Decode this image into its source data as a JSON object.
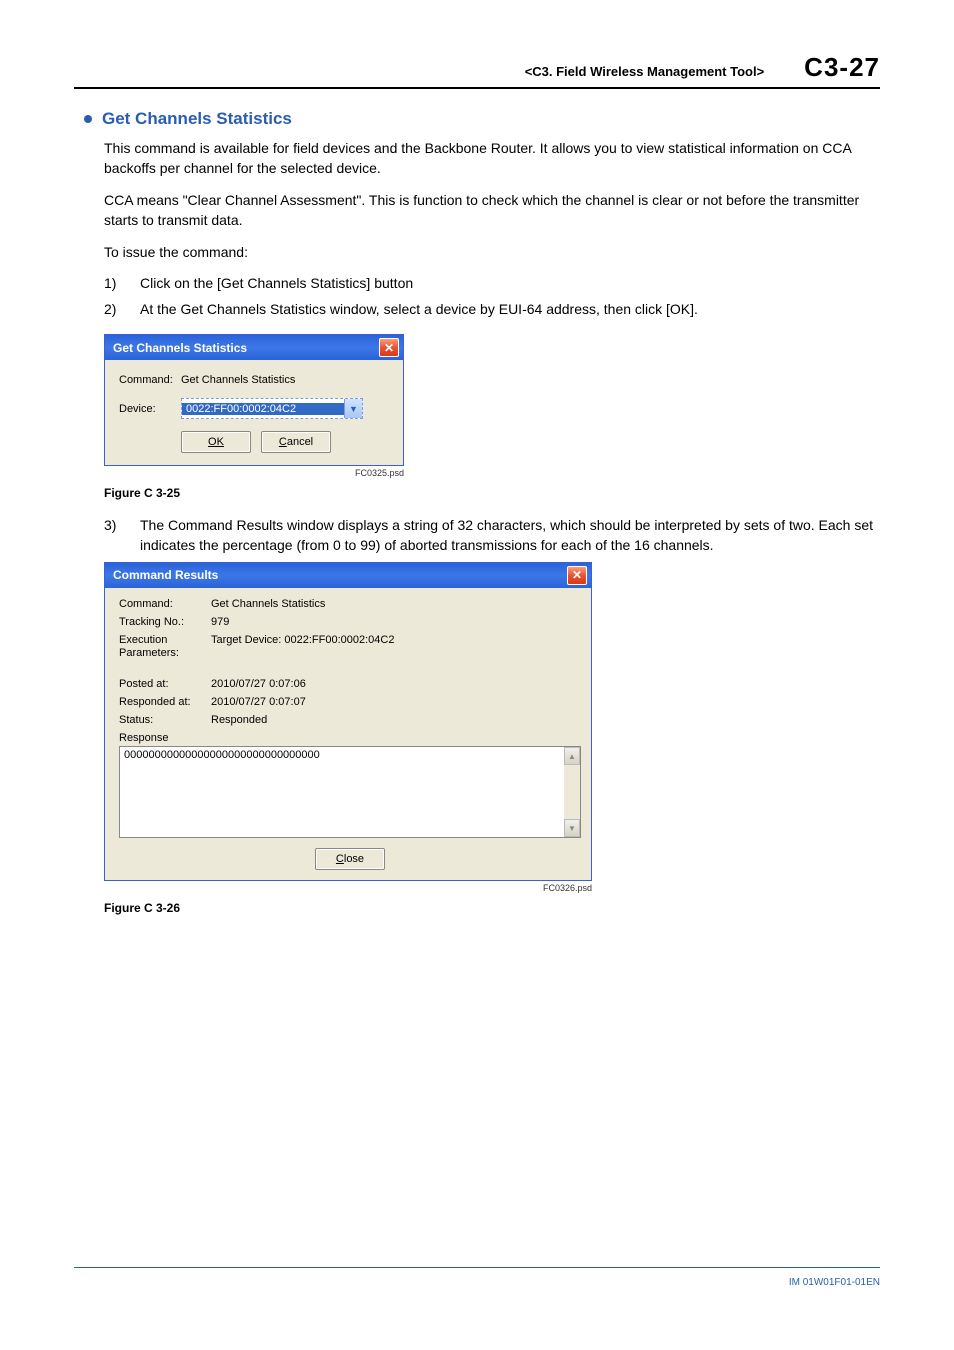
{
  "header": {
    "chapter": "<C3.  Field Wireless Management Tool>",
    "page": "C3-27"
  },
  "section": {
    "title": "Get Channels Statistics"
  },
  "body": {
    "p1": "This command is available for field devices and the Backbone Router. It allows you to view statistical information on CCA backoffs per channel for the selected device.",
    "p2": "CCA means \"Clear Channel Assessment\". This is function to check which the channel is clear or not before the transmitter starts to transmit data.",
    "p3": "To issue the command:",
    "step1": "Click on the [Get Channels Statistics] button",
    "step2": "At the Get Channels Statistics window, select a device by EUI-64 address, then click [OK].",
    "step3": "The Command Results window displays a string of 32 characters, which should be interpreted by sets of two. Each set indicates the percentage (from 0 to 99) of aborted transmissions for each of the 16 channels."
  },
  "dlg1": {
    "title": "Get Channels Statistics",
    "command_label": "Command:",
    "command_value": "Get Channels Statistics",
    "device_label": "Device:",
    "device_value": "0022:FF00:0002:04C2",
    "ok": "OK",
    "cancel": "Cancel",
    "psd": "FC0325.psd"
  },
  "figcaption1": "Figure C 3-25",
  "dlg2": {
    "title": "Command Results",
    "rows": {
      "command_l": "Command:",
      "command_v": "Get Channels Statistics",
      "tracking_l": "Tracking No.:",
      "tracking_v": "979",
      "exec_l": "Execution Parameters:",
      "exec_v": "Target Device: 0022:FF00:0002:04C2",
      "posted_l": "Posted at:",
      "posted_v": "2010/07/27 0:07:06",
      "responded_l": "Responded at:",
      "responded_v": "2010/07/27 0:07:07",
      "status_l": "Status:",
      "status_v": "Responded",
      "response_l": "Response"
    },
    "response_text": "00000000000000000000000000000000",
    "close": "Close",
    "psd": "FC0326.psd"
  },
  "figcaption2": "Figure C 3-26",
  "footer": "IM 01W01F01-01EN"
}
